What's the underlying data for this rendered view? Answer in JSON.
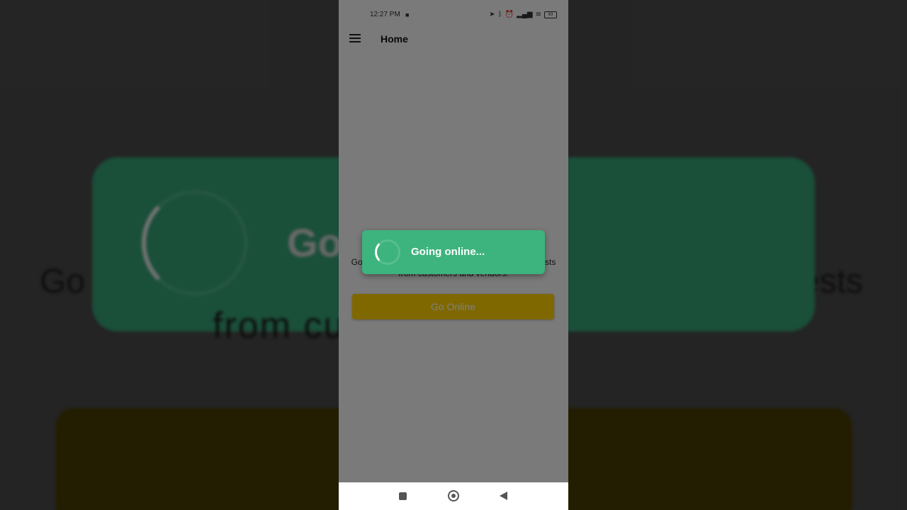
{
  "status_bar": {
    "time": "12:27 PM",
    "icons": [
      "video-camera-icon",
      "location-arrow-icon",
      "bluetooth-icon",
      "alarm-icon",
      "sim-icon",
      "signal-icon",
      "wifi-icon",
      "battery-icon"
    ],
    "battery_level": "93"
  },
  "app_bar": {
    "menu_icon": "hamburger-menu-icon",
    "title": "Home"
  },
  "main": {
    "description_left": "Go",
    "description_right": "ests",
    "description_line2": "from customers and vendors.",
    "go_online_button": "Go Online"
  },
  "toast": {
    "text": "Going online...",
    "spinner_icon": "loading-spinner-icon"
  },
  "background": {
    "title": "Go",
    "text_left": "Go",
    "text_right": "ests",
    "text_bottom": "from cu          vendors."
  },
  "colors": {
    "toast": "#3db37d",
    "button": "#ffd000",
    "overlay": "rgba(0,0,0,0.5)"
  },
  "nav_bar": {
    "items": [
      "recents-square-icon",
      "home-circle-icon",
      "back-triangle-icon"
    ]
  }
}
